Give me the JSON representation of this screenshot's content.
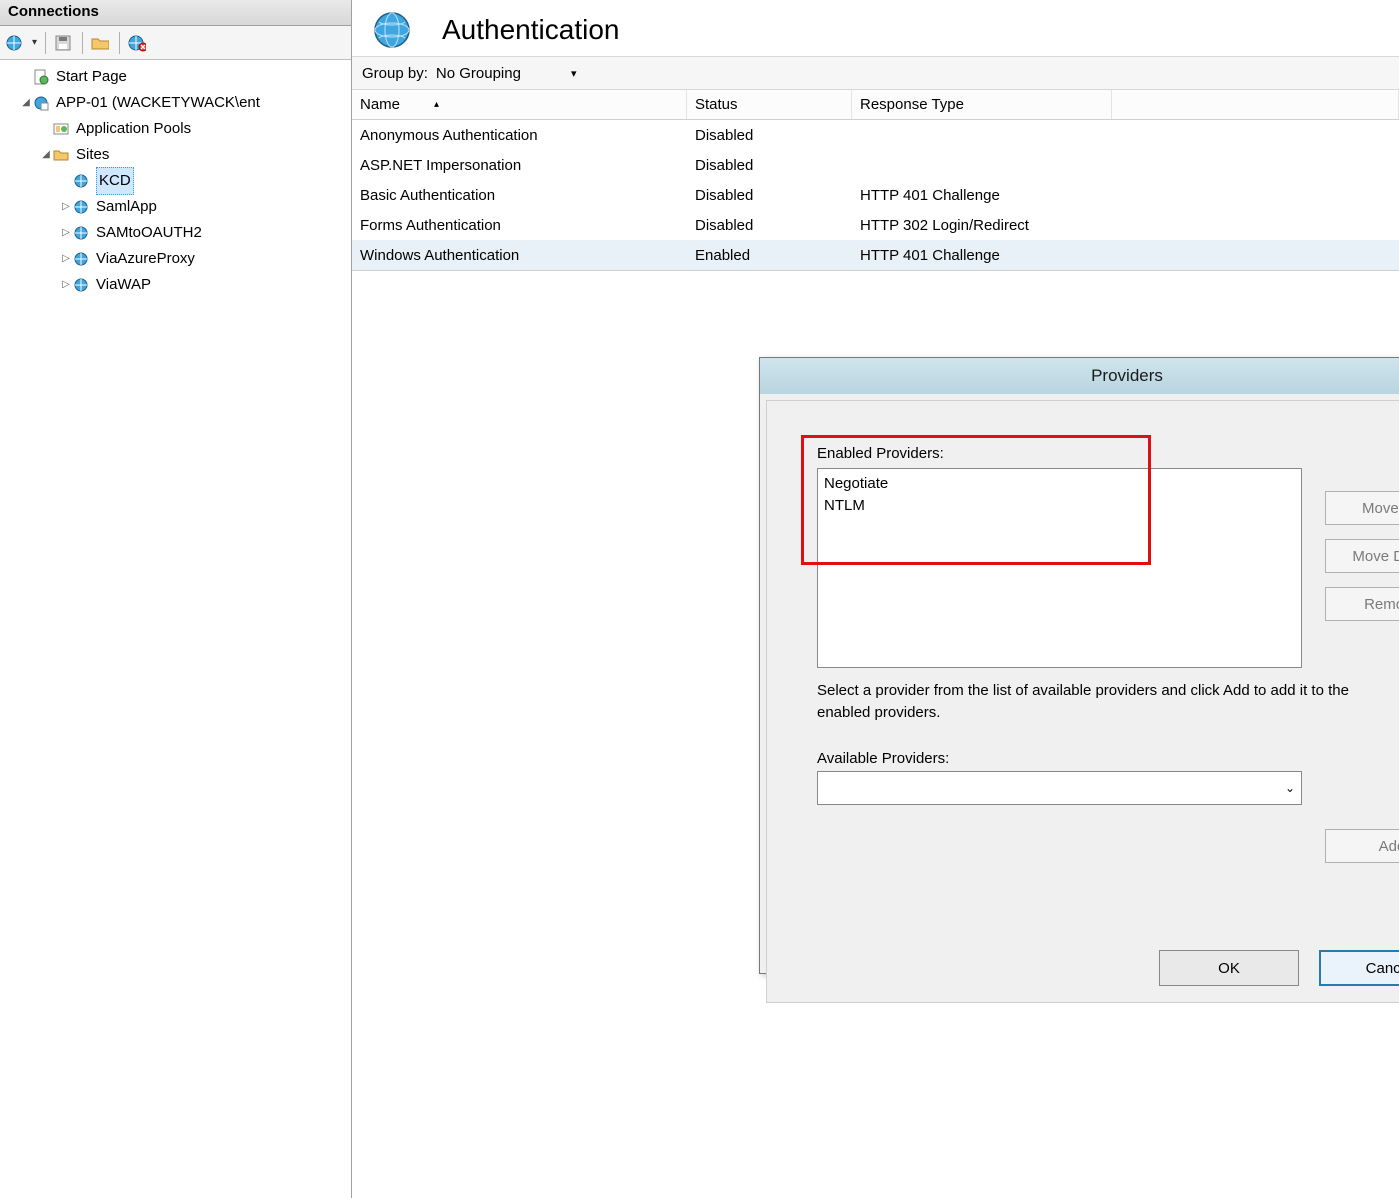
{
  "sidebar": {
    "header": "Connections",
    "tree": {
      "start_page": "Start Page",
      "server": "APP-01 (WACKETYWACK\\ent",
      "app_pools": "Application Pools",
      "sites": "Sites",
      "site_items": [
        "KCD",
        "SamlApp",
        "SAMtoOAUTH2",
        "ViaAzureProxy",
        "ViaWAP"
      ]
    }
  },
  "main": {
    "title": "Authentication",
    "group_by_label": "Group by:",
    "group_by_value": "No Grouping",
    "columns": [
      "Name",
      "Status",
      "Response Type"
    ],
    "rows": [
      {
        "name": "Anonymous Authentication",
        "status": "Disabled",
        "resp": ""
      },
      {
        "name": "ASP.NET Impersonation",
        "status": "Disabled",
        "resp": ""
      },
      {
        "name": "Basic Authentication",
        "status": "Disabled",
        "resp": "HTTP 401 Challenge"
      },
      {
        "name": "Forms Authentication",
        "status": "Disabled",
        "resp": "HTTP 302 Login/Redirect"
      },
      {
        "name": "Windows Authentication",
        "status": "Enabled",
        "resp": "HTTP 401 Challenge"
      }
    ]
  },
  "dialog": {
    "title": "Providers",
    "help": "?",
    "close": "x",
    "enabled_label": "Enabled Providers:",
    "enabled_items": [
      "Negotiate",
      "NTLM"
    ],
    "move_up": "Move Up",
    "move_down": "Move Down",
    "remove": "Remove",
    "help_text": "Select a provider from the list of available providers and click Add to add it to the enabled providers.",
    "available_label": "Available Providers:",
    "add": "Add",
    "ok": "OK",
    "cancel": "Cancel"
  }
}
